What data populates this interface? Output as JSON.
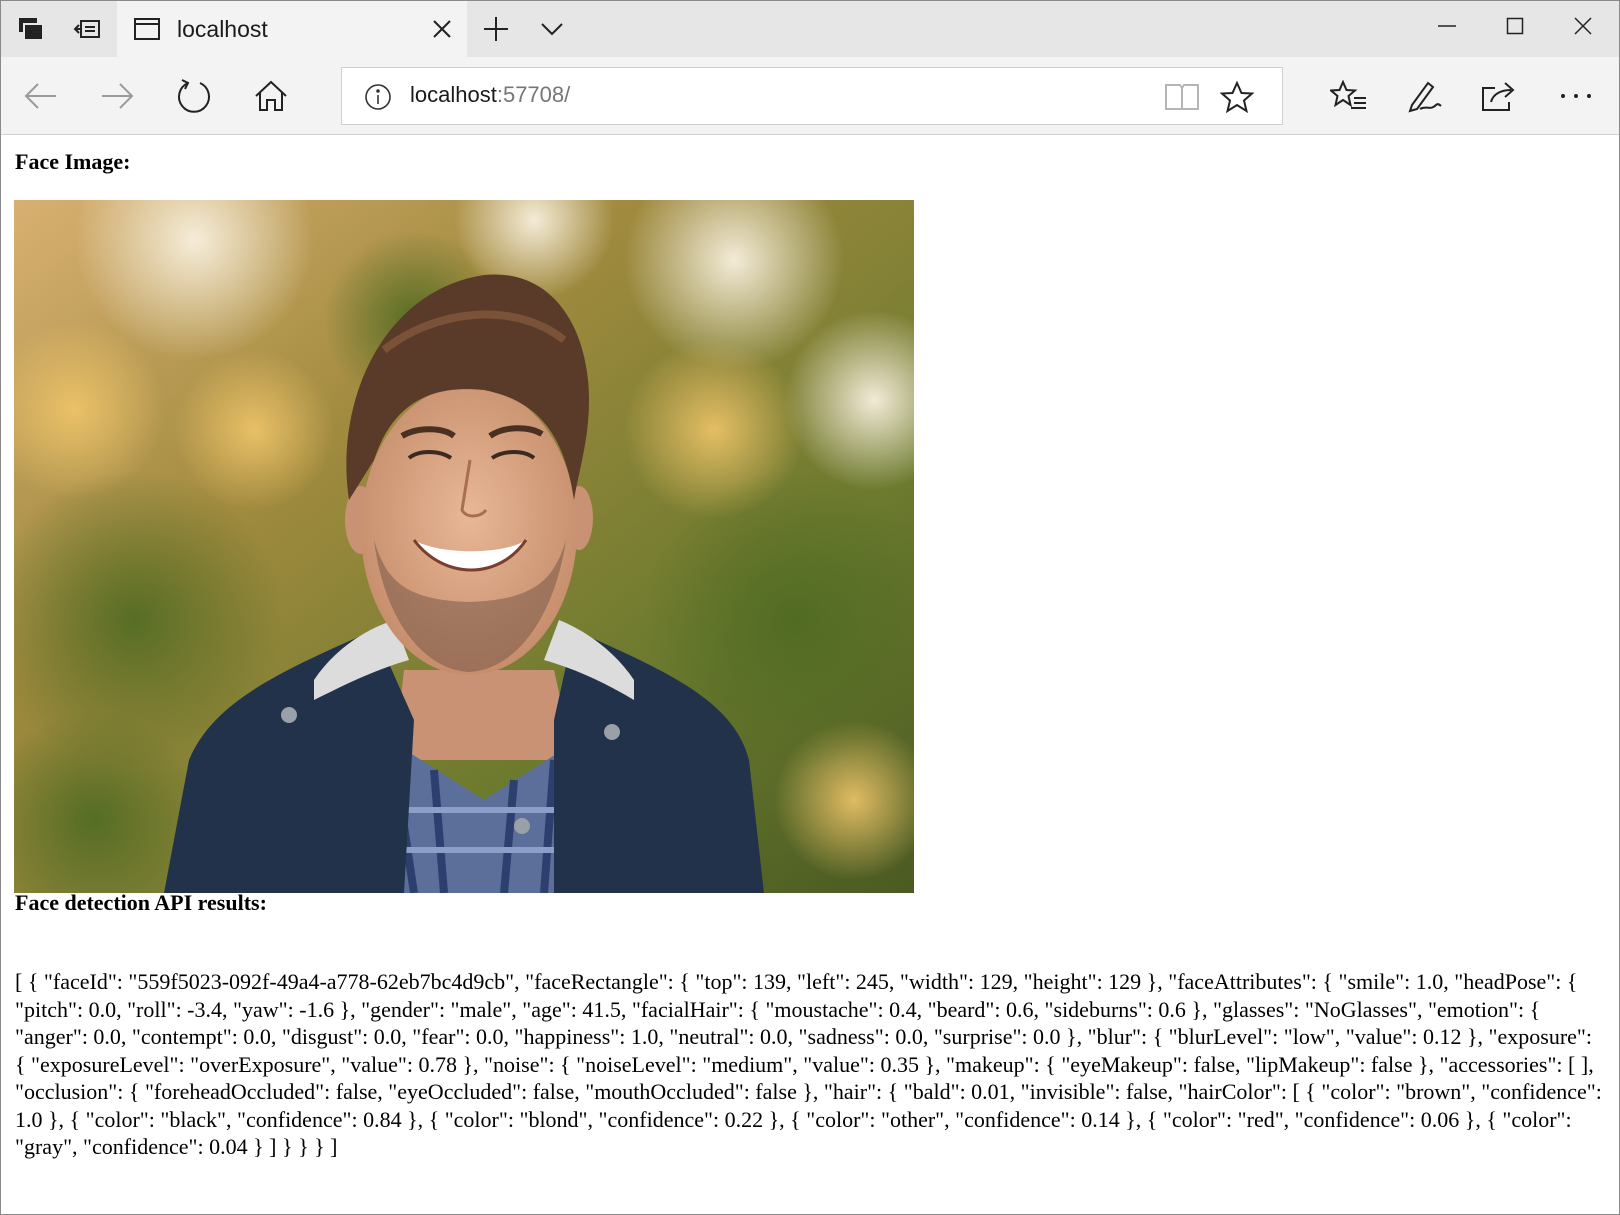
{
  "browser": {
    "tab": {
      "title": "localhost"
    },
    "address_bar": {
      "host": "localhost",
      "port_path": ":57708/"
    },
    "icons": {
      "tab_actions": "tab-actions-icon",
      "set_aside": "set-tabs-aside-icon",
      "tab_page": "page-icon",
      "tab_close": "close-icon",
      "new_tab": "plus-icon",
      "tab_preview": "chevron-down-icon",
      "minimize": "minimize-icon",
      "maximize": "maximize-icon",
      "close_window": "close-icon",
      "back": "arrow-left-icon",
      "forward": "arrow-right-icon",
      "refresh": "refresh-icon",
      "home": "home-icon",
      "site_info": "info-icon",
      "reading_view": "book-icon",
      "add_favorite": "star-icon",
      "favorites": "favorites-list-icon",
      "web_note": "pen-icon",
      "share": "share-icon",
      "more": "ellipsis-icon"
    },
    "colors": {
      "tab_bar": "#e6e6e6",
      "active_tab": "#f3f3f3",
      "toolbar": "#f3f3f3",
      "port_text": "#767676"
    }
  },
  "page": {
    "face_image_heading": "Face Image:",
    "results_heading": "Face detection API results:",
    "results_json": "[ { \"faceId\": \"559f5023-092f-49a4-a778-62eb7bc4d9cb\", \"faceRectangle\": { \"top\": 139, \"left\": 245, \"width\": 129, \"height\": 129 }, \"faceAttributes\": { \"smile\": 1.0, \"headPose\": { \"pitch\": 0.0, \"roll\": -3.4, \"yaw\": -1.6 }, \"gender\": \"male\", \"age\": 41.5, \"facialHair\": { \"moustache\": 0.4, \"beard\": 0.6, \"sideburns\": 0.6 }, \"glasses\": \"NoGlasses\", \"emotion\": { \"anger\": 0.0, \"contempt\": 0.0, \"disgust\": 0.0, \"fear\": 0.0, \"happiness\": 1.0, \"neutral\": 0.0, \"sadness\": 0.0, \"surprise\": 0.0 }, \"blur\": { \"blurLevel\": \"low\", \"value\": 0.12 }, \"exposure\": { \"exposureLevel\": \"overExposure\", \"value\": 0.78 }, \"noise\": { \"noiseLevel\": \"medium\", \"value\": 0.35 }, \"makeup\": { \"eyeMakeup\": false, \"lipMakeup\": false }, \"accessories\": [ ], \"occlusion\": { \"foreheadOccluded\": false, \"eyeOccluded\": false, \"mouthOccluded\": false }, \"hair\": { \"bald\": 0.01, \"invisible\": false, \"hairColor\": [ { \"color\": \"brown\", \"confidence\": 1.0 }, { \"color\": \"black\", \"confidence\": 0.84 }, { \"color\": \"blond\", \"confidence\": 0.22 }, { \"color\": \"other\", \"confidence\": 0.14 }, { \"color\": \"red\", \"confidence\": 0.06 }, { \"color\": \"gray\", \"confidence\": 0.04 } ] } } } ]"
  }
}
